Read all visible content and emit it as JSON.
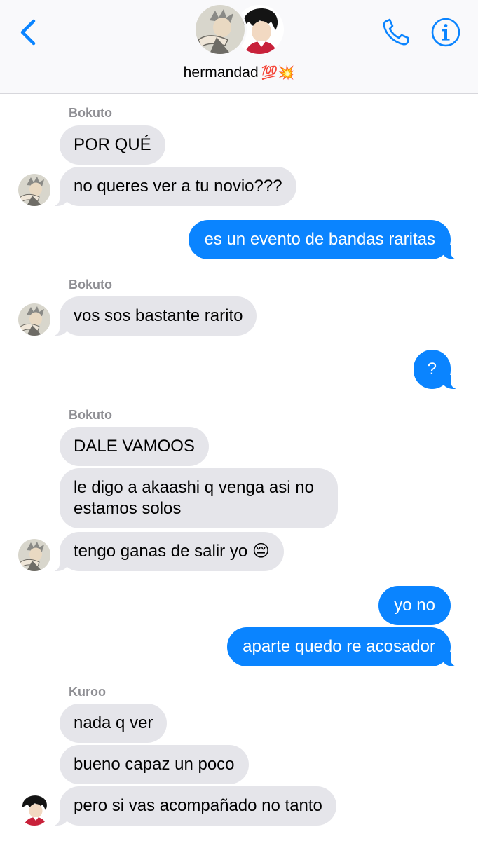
{
  "header": {
    "group_name": "hermandad",
    "group_emoji": "💯💥",
    "back_icon": "chevron-left-icon",
    "call_icon": "phone-icon",
    "info_icon": "info-icon",
    "accent_color": "#0a84ff"
  },
  "messages": [
    {
      "sender": "Bokuto",
      "text": "POR QUÉ"
    },
    {
      "text": "no queres ver a tu novio???"
    },
    {
      "text": "es un evento de bandas raritas"
    },
    {
      "sender": "Bokuto",
      "text": "vos sos bastante rarito"
    },
    {
      "text": "?"
    },
    {
      "sender": "Bokuto",
      "text": "DALE  VAMOOS"
    },
    {
      "text_line1": "le digo a akaashi q venga asi no",
      "text_line2": "estamos solos"
    },
    {
      "text": "tengo ganas de salir yo 😔"
    },
    {
      "text": "yo no"
    },
    {
      "text": "aparte quedo re acosador"
    },
    {
      "sender": "Kuroo",
      "text": "nada q ver"
    },
    {
      "text": "bueno capaz un poco"
    },
    {
      "text": "pero si vas acompañado no tanto"
    }
  ],
  "colors": {
    "incoming_bubble": "#e5e5ea",
    "outgoing_bubble": "#0a84ff",
    "sender_label": "#8e8e93"
  }
}
